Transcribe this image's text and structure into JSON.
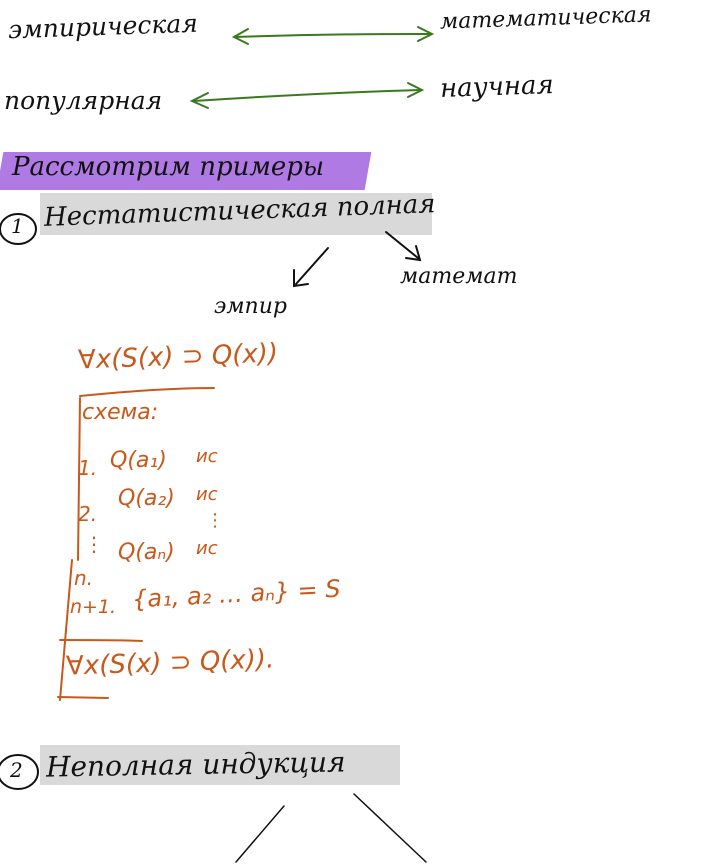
{
  "line1": {
    "left": "эмпирическая",
    "right": "математическая"
  },
  "line2": {
    "left": "популярная",
    "right": "научная"
  },
  "section_title": "Рассмотрим примеры",
  "item1": {
    "number": "1",
    "title": "Нестатистическая полная",
    "branch_left": "эмпир",
    "branch_right": "математ"
  },
  "formula": {
    "top": "∀x(S(x) ⊃ Q(x))",
    "scheme_label": "схема:",
    "rows": [
      {
        "num": "1.",
        "expr": "Q(a₁)",
        "mark": "ис"
      },
      {
        "num": "2.",
        "expr": "Q(a₂)",
        "mark": "ис"
      },
      {
        "num": "⋮",
        "expr": "",
        "mark": "⋮"
      },
      {
        "num": "n.",
        "expr": "Q(aₙ)",
        "mark": "ис"
      }
    ],
    "set_row": {
      "num": "n+1.",
      "expr": "{a₁, a₂ … aₙ} = S"
    },
    "conclusion": "∀x(S(x) ⊃ Q(x))."
  },
  "item2": {
    "number": "2",
    "title": "Неполная индукция"
  },
  "colors": {
    "ink": "#111111",
    "orange": "#c8581b",
    "green": "#3a7a1e",
    "purple_highlight": "#b07ae4",
    "gray_highlight": "#d9d9d9"
  }
}
